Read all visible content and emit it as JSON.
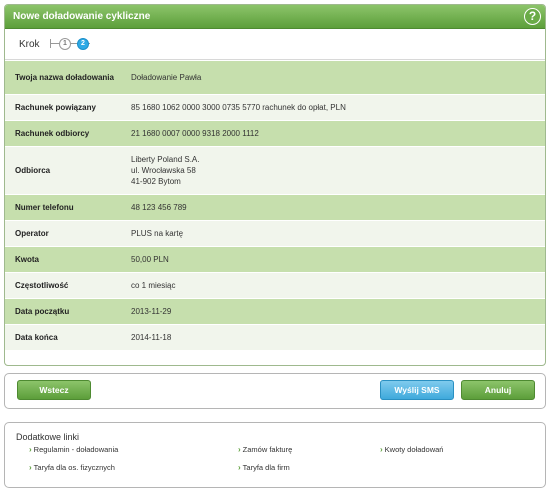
{
  "header": {
    "title": "Nowe doładowanie cykliczne",
    "help_icon": "?"
  },
  "steps": {
    "label": "Krok",
    "step1": "1",
    "step2": "2"
  },
  "details": [
    {
      "label": "Twoja nazwa doładowania",
      "value": "Doładowanie Pawła"
    },
    {
      "label": "Rachunek powiązany",
      "value": "85 1680 1062 0000 3000 0735 5770 rachunek do opłat, PLN"
    },
    {
      "label": "Rachunek odbiorcy",
      "value": "21 1680 0007 0000 9318 2000 1112"
    },
    {
      "label": "Odbiorca",
      "value_lines": [
        "Liberty Poland S.A.",
        "ul. Wrocławska 58",
        "41-902 Bytom"
      ]
    },
    {
      "label": "Numer telefonu",
      "value": "48 123 456 789"
    },
    {
      "label": "Operator",
      "value": "PLUS na kartę"
    },
    {
      "label": "Kwota",
      "value": "50,00 PLN"
    },
    {
      "label": "Częstotliwość",
      "value": "co 1 miesiąc"
    },
    {
      "label": "Data początku",
      "value": "2013-11-29"
    },
    {
      "label": "Data końca",
      "value": "2014-11-18"
    }
  ],
  "buttons": {
    "back": "Wstecz",
    "send_sms": "Wyślij SMS",
    "cancel": "Anuluj"
  },
  "links": {
    "title": "Dodatkowe linki",
    "items": [
      "Regulamin - doładowania",
      "Zamów fakturę",
      "Kwoty doładowań",
      "Taryfa dla os. fizycznych",
      "Taryfa dla firm"
    ]
  },
  "colors": {
    "accent_green": "#5d9f3b",
    "row_green": "#c6dfad",
    "row_light": "#f1f5ec",
    "accent_blue": "#3fa9dc"
  }
}
